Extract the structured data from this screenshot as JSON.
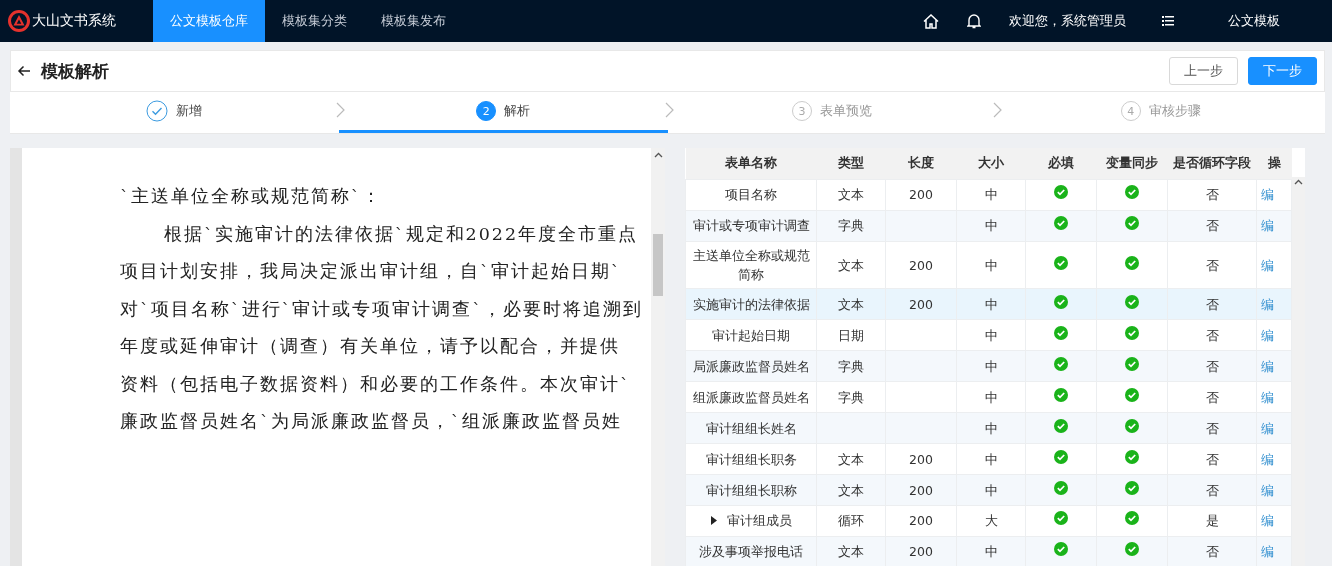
{
  "nav": {
    "brand": "大山文书系统",
    "tabs": [
      {
        "label": "公文模板仓库",
        "selected": true
      },
      {
        "label": "模板集分类",
        "selected": false
      },
      {
        "label": "模板集发布",
        "selected": false
      }
    ],
    "welcome": "欢迎您，系统管理员",
    "module": "公文模板"
  },
  "header": {
    "title": "模板解析",
    "buttons": [
      {
        "label": "上一步",
        "kind": "default"
      },
      {
        "label": "下一步",
        "kind": "primary"
      }
    ]
  },
  "steps": [
    {
      "label": "新增",
      "done": true,
      "active": false
    },
    {
      "label": "解析",
      "number": "2",
      "done": false,
      "active": true
    },
    {
      "label": "表单预览",
      "number": "3",
      "done": false,
      "active": false
    },
    {
      "label": "审核步骤",
      "number": "4",
      "done": false,
      "active": false
    }
  ],
  "document": {
    "lines": [
      {
        "text": "`主送单位全称或规范简称`：",
        "indent": false
      },
      {
        "text": "根据`实施审计的法律依据`规定和2022年度全市重点",
        "indent": true
      },
      {
        "text": "项目计划安排，我局决定派出审计组，自`审计起始日期`",
        "indent": false
      },
      {
        "text": "对`项目名称`进行`审计或专项审计调查`，必要时将追溯到",
        "indent": false
      },
      {
        "text": "年度或延伸审计（调查）有关单位，请予以配合，并提供",
        "indent": false
      },
      {
        "text": "资料（包括电子数据资料）和必要的工作条件。本次审计`",
        "indent": false
      },
      {
        "text": "廉政监督员姓名`为局派廉政监督员，`组派廉政监督员姓",
        "indent": false
      }
    ]
  },
  "table": {
    "columns": [
      "表单名称",
      "类型",
      "长度",
      "大小",
      "必填",
      "变量同步",
      "是否循环字段",
      "操"
    ],
    "rows": [
      {
        "name": "项目名称",
        "type": "文本",
        "length": "200",
        "size": "中",
        "required": true,
        "sync": true,
        "loop": "否",
        "action": "编",
        "expandable": false,
        "highlighted": false
      },
      {
        "name": "审计或专项审计调查",
        "type": "字典",
        "size": "中",
        "required": true,
        "sync": true,
        "loop": "否",
        "action": "编",
        "expandable": false,
        "highlighted": false
      },
      {
        "name": "主送单位全称或规范简称",
        "type": "文本",
        "length": "200",
        "size": "中",
        "required": true,
        "sync": true,
        "loop": "否",
        "action": "编",
        "expandable": false,
        "highlighted": false
      },
      {
        "name": "实施审计的法律依据",
        "type": "文本",
        "length": "200",
        "size": "中",
        "required": true,
        "sync": true,
        "loop": "否",
        "action": "编",
        "expandable": false,
        "highlighted": true
      },
      {
        "name": "审计起始日期",
        "type": "日期",
        "size": "中",
        "required": true,
        "sync": true,
        "loop": "否",
        "action": "编",
        "expandable": false,
        "highlighted": false
      },
      {
        "name": "局派廉政监督员姓名",
        "type": "字典",
        "size": "中",
        "required": true,
        "sync": true,
        "loop": "否",
        "action": "编",
        "expandable": false,
        "highlighted": false
      },
      {
        "name": "组派廉政监督员姓名",
        "type": "字典",
        "size": "中",
        "required": true,
        "sync": true,
        "loop": "否",
        "action": "编",
        "expandable": false,
        "highlighted": false
      },
      {
        "name": "审计组组长姓名",
        "size": "中",
        "required": true,
        "sync": true,
        "loop": "否",
        "action": "编",
        "expandable": false,
        "highlighted": false
      },
      {
        "name": "审计组组长职务",
        "type": "文本",
        "length": "200",
        "size": "中",
        "required": true,
        "sync": true,
        "loop": "否",
        "action": "编",
        "expandable": false,
        "highlighted": false
      },
      {
        "name": "审计组组长职称",
        "type": "文本",
        "length": "200",
        "size": "中",
        "required": true,
        "sync": true,
        "loop": "否",
        "action": "编",
        "expandable": false,
        "highlighted": false
      },
      {
        "name": "审计组成员",
        "type": "循环",
        "length": "200",
        "size": "大",
        "required": true,
        "sync": true,
        "loop": "是",
        "action": "编",
        "expandable": true,
        "highlighted": false
      },
      {
        "name": "涉及事项举报电话",
        "type": "文本",
        "length": "200",
        "size": "中",
        "required": true,
        "sync": true,
        "loop": "否",
        "action": "编",
        "expandable": false,
        "highlighted": false
      }
    ]
  }
}
